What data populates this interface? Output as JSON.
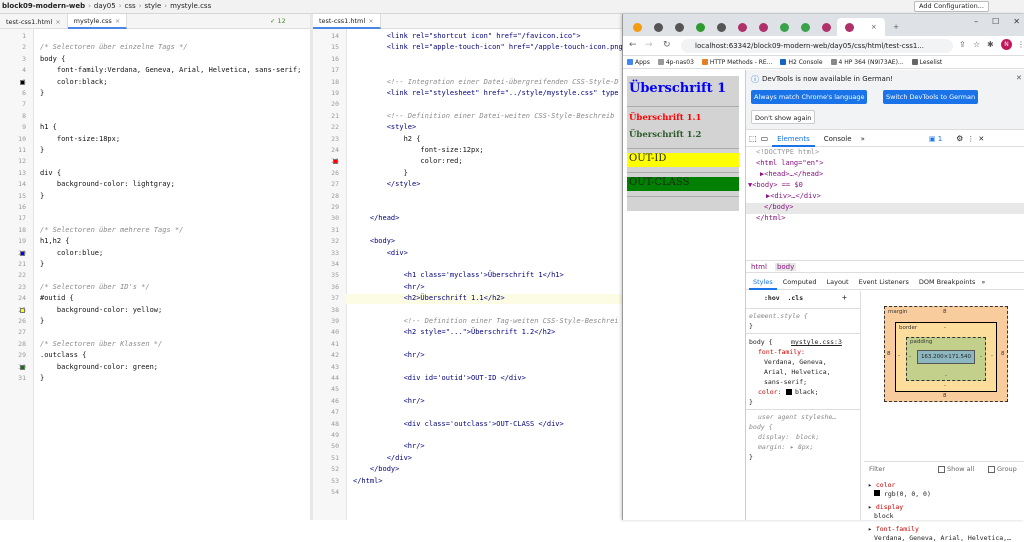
{
  "topbar": {
    "crumbs": [
      "block09-modern-web",
      "day05",
      "css",
      "style",
      "mystyle.css"
    ],
    "add_config": "Add Configuration..."
  },
  "left_editor": {
    "tabs": [
      {
        "label": "test-css1.html"
      },
      {
        "label": "mystyle.css",
        "active": true
      }
    ],
    "warnings": "12",
    "lines": [
      {
        "n": "1",
        "t": ""
      },
      {
        "n": "2",
        "t": "/* Selectoren über einzelne Tags */"
      },
      {
        "n": "3",
        "t": "body {"
      },
      {
        "n": "4",
        "t": "    font-family:Verdana, Geneva, Arial, Helvetica, sans-serif;"
      },
      {
        "n": "5",
        "t": "    color:black;"
      },
      {
        "n": "6",
        "t": "}"
      },
      {
        "n": "7",
        "t": ""
      },
      {
        "n": "8",
        "t": ""
      },
      {
        "n": "9",
        "t": "h1 {"
      },
      {
        "n": "10",
        "t": "    font-size:18px;"
      },
      {
        "n": "11",
        "t": "}"
      },
      {
        "n": "12",
        "t": ""
      },
      {
        "n": "13",
        "t": "div {"
      },
      {
        "n": "14",
        "t": "    background-color: lightgray;"
      },
      {
        "n": "15",
        "t": "}"
      },
      {
        "n": "16",
        "t": ""
      },
      {
        "n": "17",
        "t": ""
      },
      {
        "n": "18",
        "t": "/* Selectoren über mehrere Tags */"
      },
      {
        "n": "19",
        "t": "h1,h2 {"
      },
      {
        "n": "20",
        "t": "    color:blue;"
      },
      {
        "n": "21",
        "t": "}"
      },
      {
        "n": "22",
        "t": ""
      },
      {
        "n": "23",
        "t": "/* Selectoren über ID's */"
      },
      {
        "n": "24",
        "t": "#outid {"
      },
      {
        "n": "25",
        "t": "    background-color: yellow;"
      },
      {
        "n": "26",
        "t": "}"
      },
      {
        "n": "27",
        "t": ""
      },
      {
        "n": "28",
        "t": "/* Selectoren über Klassen */"
      },
      {
        "n": "29",
        "t": ".outclass {"
      },
      {
        "n": "30",
        "t": "    background-color: green;"
      },
      {
        "n": "31",
        "t": "}"
      }
    ]
  },
  "right_editor": {
    "tabs": [
      {
        "label": "test-css1.html",
        "active": true
      }
    ],
    "lines": [
      {
        "n": "14",
        "t": "        <link rel=\"shortcut icon\" href=\"/favicon.ico\">"
      },
      {
        "n": "15",
        "t": "        <link rel=\"apple-touch-icon\" href=\"/apple-touch-icon.png"
      },
      {
        "n": "16",
        "t": ""
      },
      {
        "n": "17",
        "t": ""
      },
      {
        "n": "18",
        "t": "        <!-- Integration einer Datei-übergreifenden CSS-Style-D"
      },
      {
        "n": "19",
        "t": "        <link rel=\"stylesheet\" href=\"../style/mystyle.css\" type"
      },
      {
        "n": "20",
        "t": ""
      },
      {
        "n": "21",
        "t": "        <!-- Definition einer Datei-weiten CSS-Style-Beschreib"
      },
      {
        "n": "22",
        "t": "        <style>"
      },
      {
        "n": "23",
        "t": "            h2 {"
      },
      {
        "n": "24",
        "t": "                font-size:12px;"
      },
      {
        "n": "25",
        "t": "                color:red;"
      },
      {
        "n": "26",
        "t": "            }"
      },
      {
        "n": "27",
        "t": "        </style>"
      },
      {
        "n": "28",
        "t": ""
      },
      {
        "n": "29",
        "t": ""
      },
      {
        "n": "30",
        "t": "    </head>"
      },
      {
        "n": "31",
        "t": ""
      },
      {
        "n": "32",
        "t": "    <body>"
      },
      {
        "n": "33",
        "t": "        <div>"
      },
      {
        "n": "34",
        "t": ""
      },
      {
        "n": "35",
        "t": "            <h1 class='myclass'>Überschrift 1</h1>"
      },
      {
        "n": "36",
        "t": "            <hr/>"
      },
      {
        "n": "37",
        "t": "            <h2>Überschrift 1.1</h2>"
      },
      {
        "n": "38",
        "t": ""
      },
      {
        "n": "39",
        "t": "            <!-- Definition einer Tag-weiten CSS-Style-Beschrei"
      },
      {
        "n": "40",
        "t": "            <h2 style=\"...\">Überschrift 1.2</h2>"
      },
      {
        "n": "41",
        "t": ""
      },
      {
        "n": "42",
        "t": "            <hr/>"
      },
      {
        "n": "43",
        "t": ""
      },
      {
        "n": "44",
        "t": "            <div id='outid'>OUT-ID </div>"
      },
      {
        "n": "45",
        "t": ""
      },
      {
        "n": "46",
        "t": "            <hr/>"
      },
      {
        "n": "47",
        "t": ""
      },
      {
        "n": "48",
        "t": "            <div class='outclass'>OUT-CLASS </div>"
      },
      {
        "n": "49",
        "t": ""
      },
      {
        "n": "50",
        "t": "            <hr/>"
      },
      {
        "n": "51",
        "t": "        </div>"
      },
      {
        "n": "52",
        "t": "    </body>"
      },
      {
        "n": "53",
        "t": "</html>"
      },
      {
        "n": "54",
        "t": ""
      }
    ]
  },
  "browser": {
    "address": "localhost:63342/block09-modern-web/day05/css/html/test-css1...",
    "bookmarks": [
      "Apps",
      "4p-nas03",
      "HTTP Methods - RE...",
      "H2 Console",
      "4 HP 364 (N9I73AE)...",
      "Leselist"
    ],
    "page": {
      "h1": "Überschrift 1",
      "h2a": "Überschrift 1.1",
      "h2b": "Überschrift 1.2",
      "outid": "OUT-ID",
      "outclass": "OUT-CLASS"
    }
  },
  "devtools": {
    "banner": "DevTools is now available in German!",
    "btn_match": "Always match Chrome's language",
    "btn_switch": "Switch DevTools to German",
    "btn_dont": "Don't show again",
    "tabs": [
      "Elements",
      "Console"
    ],
    "badge": "1",
    "dom": [
      "<!DOCTYPE html>",
      "<html lang=\"en\">",
      "▶<head>…</head>",
      "▼<body> == $0",
      "▶<div>…</div>",
      "</body>",
      "</html>"
    ],
    "crumbs": [
      "html",
      "body"
    ],
    "style_tabs": [
      "Styles",
      "Computed",
      "Layout",
      "Event Listeners",
      "DOM Breakpoints"
    ],
    "hov": ":hov  .cls",
    "element_style": "element.style {",
    "rule_body": "body {",
    "rule_src": "mystyle.css:3",
    "ff": "font-family:",
    "ff_val": "Verdana, Geneva,",
    "ff_val2": "Arial, Helvetica,",
    "ff_val3": "sans-serif;",
    "color": "color:",
    "color_val": "black;",
    "ua": "user agent styleshe…",
    "ua_body": "body {",
    "display": "display:",
    "display_val": "block;",
    "margin": "margin:",
    "margin_val": "▸ 8px;",
    "close": "}",
    "box": {
      "margin_label": "margin",
      "margin_val": "8",
      "border_label": "border",
      "border_val": "-",
      "padding_label": "padding",
      "padding_val": "-",
      "content": "163.200×171.540"
    },
    "filter": "Filter",
    "show_all": "Show all",
    "group": "Group",
    "computed": [
      {
        "p": "color",
        "v": "rgb(0, 0, 0)"
      },
      {
        "p": "display",
        "v": "block"
      },
      {
        "p": "font-family",
        "v": "Verdana, Geneva, Arial, Helvetica,…"
      }
    ]
  }
}
